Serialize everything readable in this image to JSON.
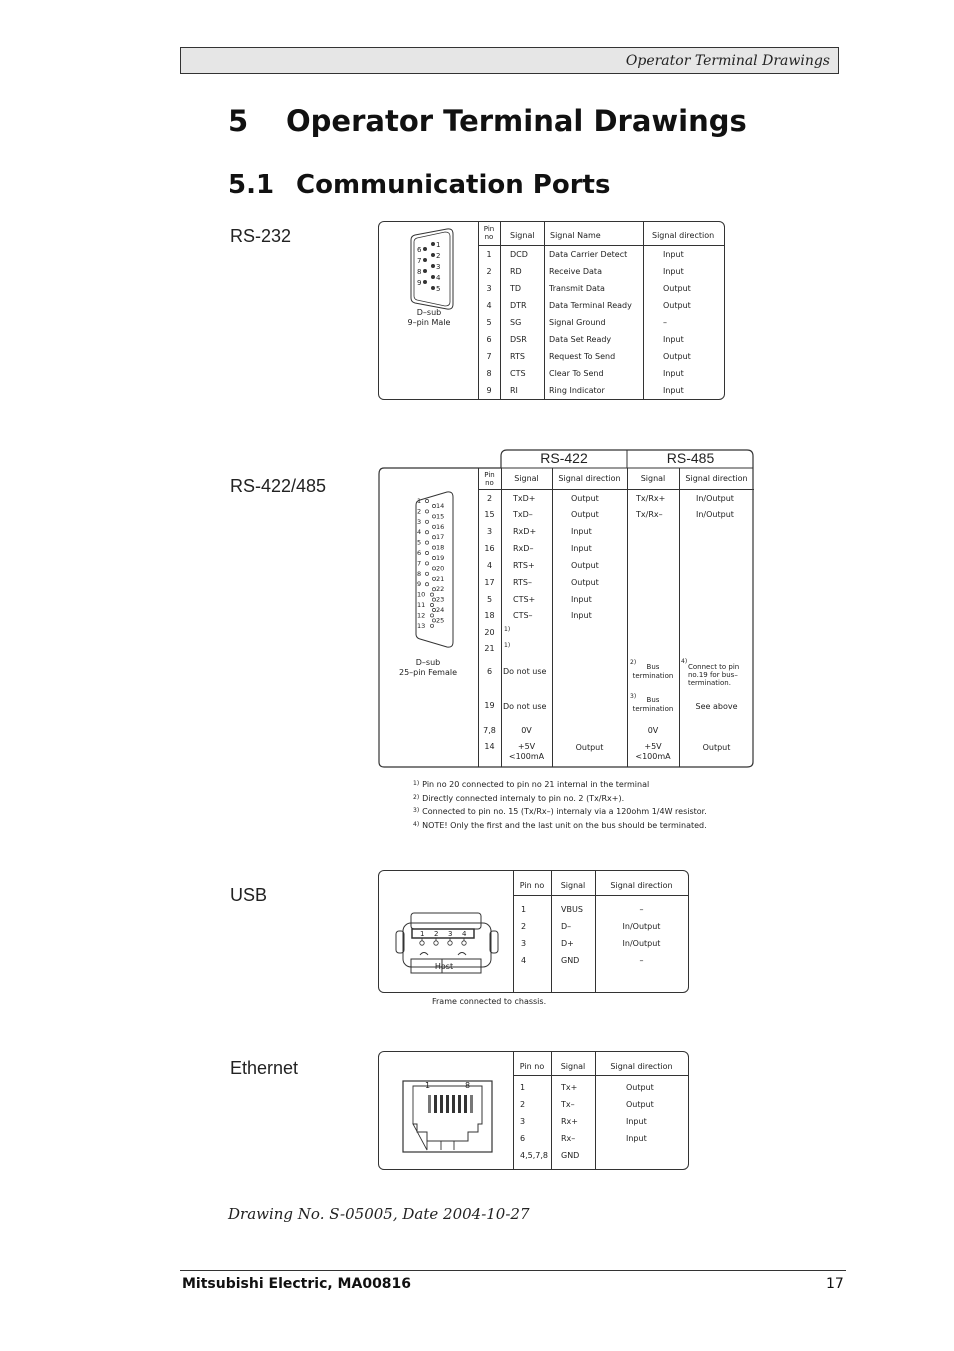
{
  "header": {
    "running_title": "Operator Terminal Drawings"
  },
  "chapter": {
    "number": "5",
    "title": "Operator Terminal Drawings"
  },
  "section": {
    "number": "5.1",
    "title": "Communication Ports"
  },
  "rs232": {
    "label": "RS-232",
    "connector": {
      "line1": "D–sub",
      "line2": "9–pin Male",
      "pins_left": [
        "6",
        "7",
        "8",
        "9"
      ],
      "pins_right": [
        "1",
        "2",
        "3",
        "4",
        "5"
      ]
    },
    "headers": {
      "pin_no_1": "Pin",
      "pin_no_2": "no",
      "signal": "Signal",
      "signal_name": "Signal Name",
      "signal_direction": "Signal direction"
    },
    "rows": [
      {
        "pin": "1",
        "signal": "DCD",
        "name": "Data Carrier Detect",
        "direction": "Input"
      },
      {
        "pin": "2",
        "signal": "RD",
        "name": "Receive Data",
        "direction": "Input"
      },
      {
        "pin": "3",
        "signal": "TD",
        "name": "Transmit Data",
        "direction": "Output"
      },
      {
        "pin": "4",
        "signal": "DTR",
        "name": "Data Terminal Ready",
        "direction": "Output"
      },
      {
        "pin": "5",
        "signal": "SG",
        "name": "Signal Ground",
        "direction": "–"
      },
      {
        "pin": "6",
        "signal": "DSR",
        "name": "Data Set Ready",
        "direction": "Input"
      },
      {
        "pin": "7",
        "signal": "RTS",
        "name": "Request To Send",
        "direction": "Output"
      },
      {
        "pin": "8",
        "signal": "CTS",
        "name": "Clear To Send",
        "direction": "Input"
      },
      {
        "pin": "9",
        "signal": "RI",
        "name": "Ring Indicator",
        "direction": "Input"
      }
    ]
  },
  "rs422_485": {
    "label": "RS-422/485",
    "group_422": "RS-422",
    "group_485": "RS-485",
    "connector": {
      "line1": "D–sub",
      "line2": "25–pin Female",
      "pins_left": [
        "1",
        "2",
        "3",
        "4",
        "5",
        "6",
        "7",
        "8",
        "9",
        "10",
        "11",
        "12",
        "13"
      ],
      "pins_right": [
        "14",
        "15",
        "16",
        "17",
        "18",
        "19",
        "20",
        "21",
        "22",
        "23",
        "24",
        "25"
      ]
    },
    "headers": {
      "pin_no_1": "Pin",
      "pin_no_2": "no",
      "signal_422": "Signal",
      "direction_422": "Signal direction",
      "signal_485": "Signal",
      "direction_485": "Signal direction"
    },
    "rows": [
      {
        "pin": "2",
        "sig422": "TxD+",
        "dir422": "Output",
        "sig485": "Tx/Rx+",
        "dir485": "In/Output"
      },
      {
        "pin": "15",
        "sig422": "TxD–",
        "dir422": "Output",
        "sig485": "Tx/Rx–",
        "dir485": "In/Output"
      },
      {
        "pin": "3",
        "sig422": "RxD+",
        "dir422": "Input",
        "sig485": "",
        "dir485": ""
      },
      {
        "pin": "16",
        "sig422": "RxD–",
        "dir422": "Input",
        "sig485": "",
        "dir485": ""
      },
      {
        "pin": "4",
        "sig422": "RTS+",
        "dir422": "Output",
        "sig485": "",
        "dir485": ""
      },
      {
        "pin": "17",
        "sig422": "RTS–",
        "dir422": "Output",
        "sig485": "",
        "dir485": ""
      },
      {
        "pin": "5",
        "sig422": "CTS+",
        "dir422": "Input",
        "sig485": "",
        "dir485": ""
      },
      {
        "pin": "18",
        "sig422": "CTS–",
        "dir422": "Input",
        "sig485": "",
        "dir485": ""
      },
      {
        "pin": "20",
        "sig422": "1)",
        "dir422": "",
        "sig485": "",
        "dir485": ""
      },
      {
        "pin": "21",
        "sig422": "1)",
        "dir422": "",
        "sig485": "",
        "dir485": ""
      }
    ],
    "special_rows": {
      "pin6": {
        "pin": "6",
        "sig422": "Do not use",
        "sig485_mark": "2)",
        "sig485_l1": "Bus",
        "sig485_l2": "termination",
        "dir485_mark": "4)",
        "dir485_l1": "Connect to pin",
        "dir485_l2": "no.19 for bus–",
        "dir485_l3": "termination."
      },
      "pin19": {
        "pin": "19",
        "sig422": "Do not use",
        "sig485_mark": "3)",
        "sig485_l1": "Bus",
        "sig485_l2": "termination",
        "dir485": "See above"
      },
      "pin78": {
        "pin": "7,8",
        "sig422": "0V",
        "sig485": "0V"
      },
      "pin14": {
        "pin": "14",
        "sig422_l1": "+5V",
        "sig422_l2": "<100mA",
        "dir422": "Output",
        "sig485_l1": "+5V",
        "sig485_l2": "<100mA",
        "dir485": "Output"
      }
    },
    "footnotes": [
      {
        "mark": "1)",
        "text": "Pin no 20 connected to pin no 21 internal in the terminal"
      },
      {
        "mark": "2)",
        "text": "Directly connected internaly to pin no. 2 (Tx/Rx+)."
      },
      {
        "mark": "3)",
        "text": "Connected to pin no. 15 (Tx/Rx–) internaly via a 120ohm 1/4W resistor."
      },
      {
        "mark": "4)",
        "text": "NOTE! Only the first and the last unit on the bus should be terminated."
      }
    ]
  },
  "usb": {
    "label": "USB",
    "connector": {
      "caption": "Host",
      "pins": [
        "1",
        "2",
        "3",
        "4"
      ]
    },
    "headers": {
      "pin_no": "Pin no",
      "signal": "Signal",
      "signal_direction": "Signal direction"
    },
    "rows": [
      {
        "pin": "1",
        "signal": "VBUS",
        "direction": "–"
      },
      {
        "pin": "2",
        "signal": "D–",
        "direction": "In/Output"
      },
      {
        "pin": "3",
        "signal": "D+",
        "direction": "In/Output"
      },
      {
        "pin": "4",
        "signal": "GND",
        "direction": "–"
      }
    ],
    "note": "Frame connected to chassis."
  },
  "ethernet": {
    "label": "Ethernet",
    "connector": {
      "pin_first": "1",
      "pin_last": "8"
    },
    "headers": {
      "pin_no": "Pin no",
      "signal": "Signal",
      "signal_direction": "Signal direction"
    },
    "rows": [
      {
        "pin": "1",
        "signal": "Tx+",
        "direction": "Output"
      },
      {
        "pin": "2",
        "signal": "Tx–",
        "direction": "Output"
      },
      {
        "pin": "3",
        "signal": "Rx+",
        "direction": "Input"
      },
      {
        "pin": "6",
        "signal": "Rx–",
        "direction": "Input"
      },
      {
        "pin": "4,5,7,8",
        "signal": "GND",
        "direction": ""
      }
    ]
  },
  "caption": "Drawing No. S-05005, Date 2004-10-27",
  "footer": {
    "left": "Mitsubishi Electric, MA00816",
    "page": "17"
  }
}
